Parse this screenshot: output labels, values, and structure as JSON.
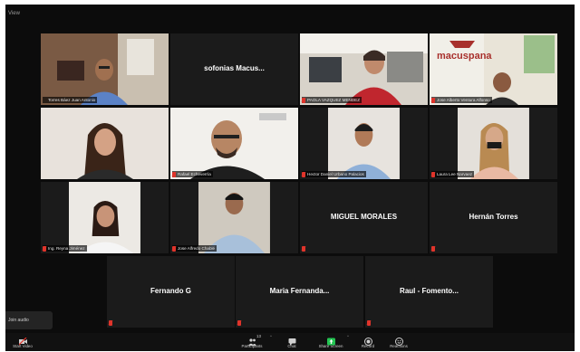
{
  "window": {
    "view_label": "View"
  },
  "tiles": [
    {
      "id": "t1",
      "name": "Torres Báez Juan Antonio",
      "type": "video",
      "muted": false,
      "active": true
    },
    {
      "id": "t2",
      "name": "sofonias  Macus...",
      "type": "name-only",
      "muted": true
    },
    {
      "id": "t3",
      "name": "PAOLA VAZQUEZ MENDEZ",
      "type": "video",
      "muted": true
    },
    {
      "id": "t4",
      "name": "Jose Alberto Ventura Alfonso",
      "type": "video",
      "muted": true,
      "brand_text": "macuspana"
    },
    {
      "id": "t5",
      "name": "",
      "type": "video",
      "muted": false
    },
    {
      "id": "t6",
      "name": "Rafael Echeverría",
      "type": "video",
      "muted": true
    },
    {
      "id": "t7",
      "name": "Hector Daniel Urbano Palacios",
      "type": "video",
      "muted": true
    },
    {
      "id": "t8",
      "name": "Laura Lee Narvaez",
      "type": "video",
      "muted": true
    },
    {
      "id": "t9",
      "name": "Ing. Reyna Jiménez",
      "type": "video",
      "muted": true
    },
    {
      "id": "t10",
      "name": "Jose Alfredo Chablé",
      "type": "video",
      "muted": true
    },
    {
      "id": "t11",
      "name": "MIGUEL MORALES",
      "type": "name-only",
      "muted": true
    },
    {
      "id": "t12",
      "name": "Hernán Torres",
      "type": "name-only",
      "muted": true
    },
    {
      "id": "t13",
      "name": "Fernando G",
      "type": "name-only",
      "muted": true
    },
    {
      "id": "t14",
      "name": "Maria Fernanda...",
      "type": "name-only",
      "muted": true
    },
    {
      "id": "t15",
      "name": "Raul  - Fomento...",
      "type": "name-only",
      "muted": true
    }
  ],
  "join_audio": {
    "label": "Join audio"
  },
  "toolbar": {
    "start_video": "Start Video",
    "participants": "Participants",
    "participant_count": "13",
    "chat": "Chat",
    "share_screen": "Share Screen",
    "record": "Record",
    "reactions": "Reactions"
  },
  "colors": {
    "active_speaker_border": "#d8c200",
    "muted_icon": "#e0342b",
    "share_screen_green": "#23c552"
  }
}
